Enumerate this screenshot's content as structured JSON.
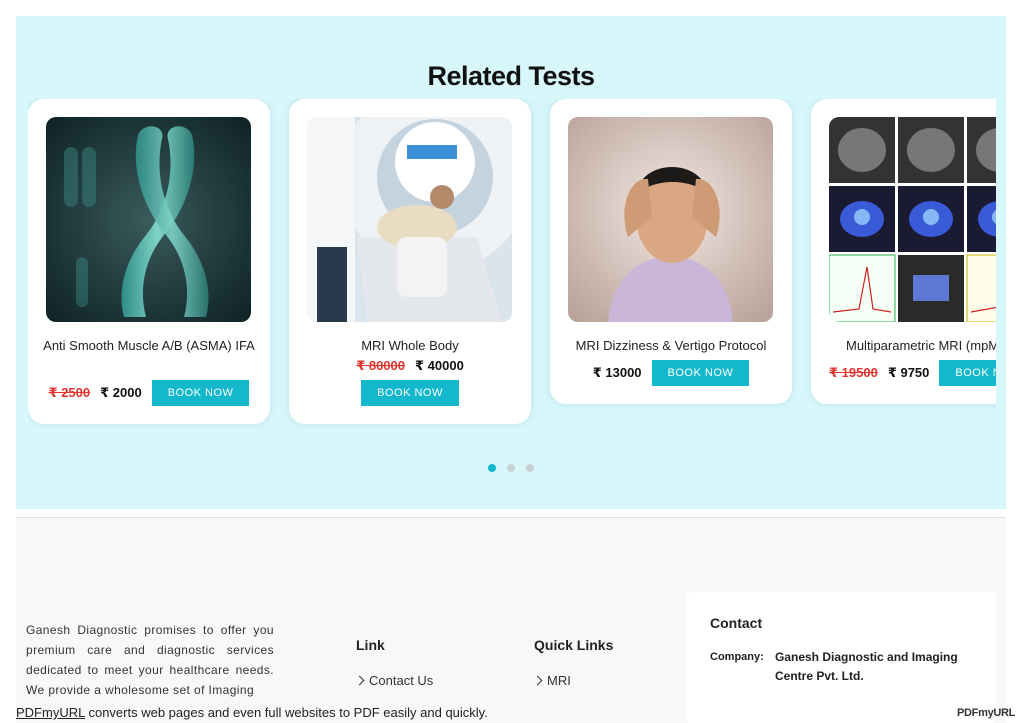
{
  "related": {
    "title": "Related Tests",
    "cards": [
      {
        "name": "Anti Smooth Muscle A/B (ASMA) IFA",
        "old_price": "₹ 2500",
        "new_price": "₹ 2000",
        "button": "BOOK NOW",
        "image": "chromosome-image"
      },
      {
        "name": "MRI Whole Body",
        "old_price": "₹ 80000",
        "new_price": "₹ 40000",
        "button": "BOOK NOW",
        "image": "mri-scanner-image"
      },
      {
        "name": "MRI Dizziness & Vertigo Protocol",
        "old_price": "",
        "new_price": "₹ 13000",
        "button": "BOOK NOW",
        "image": "headache-man-image"
      },
      {
        "name": "Multiparametric MRI (mpM",
        "old_price": "₹ 19500",
        "new_price": "₹ 9750",
        "button": "BOOK N",
        "image": "mri-scans-grid-image"
      }
    ],
    "pagination": {
      "active": 1,
      "total": 3
    }
  },
  "footer": {
    "about": "Ganesh Diagnostic promises to offer you premium care and diagnostic services dedicated to meet your healthcare needs. We provide a wholesome set of Imaging",
    "link_title": "Link",
    "links": [
      "Contact Us"
    ],
    "quick_links_title": "Quick Links",
    "quick_links": [
      "MRI"
    ],
    "contact": {
      "title": "Contact",
      "company_label": "Company:",
      "company_value": "Ganesh Diagnostic and Imaging Centre Pvt. Ltd."
    }
  },
  "pdf_banner": {
    "link": "PDFmyURL",
    "text": " converts web pages and even full websites to PDF easily and quickly.",
    "logo": "PDFmyURL"
  },
  "colors": {
    "accent": "#13b8cc",
    "strike": "#e3342f",
    "section_bg": "#d7f7fb"
  }
}
